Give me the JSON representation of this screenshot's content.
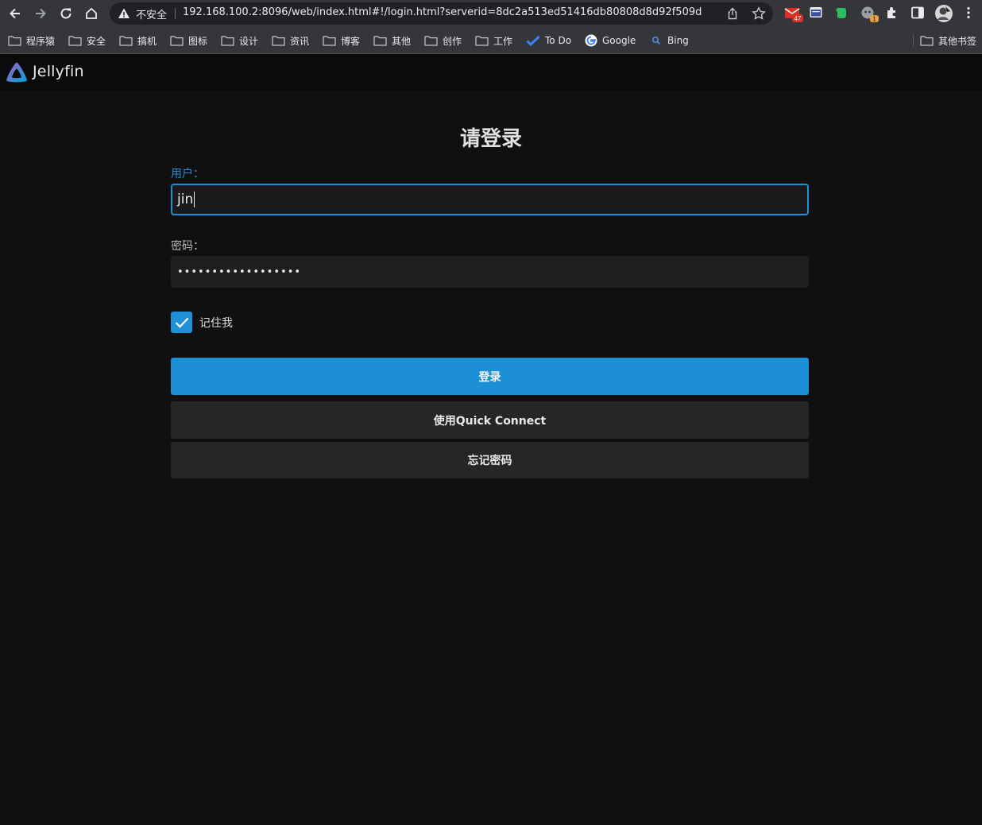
{
  "browser": {
    "omnibox": {
      "security_label": "不安全",
      "url": "192.168.100.2:8096/web/index.html#!/login.html?serverid=8dc2a513ed51416db80808d8d92f509d"
    },
    "extensions": [
      {
        "icon": "mail-extension-icon",
        "badge": "47"
      },
      {
        "icon": "window-extension-icon"
      },
      {
        "icon": "evernote-extension-icon"
      },
      {
        "icon": "wechat-extension-icon",
        "badge": "1"
      },
      {
        "icon": "puzzle-icon"
      },
      {
        "icon": "sidebar-icon"
      },
      {
        "icon": "profile-avatar-icon"
      },
      {
        "icon": "more-vert-icon"
      }
    ],
    "bookmarks": [
      {
        "label": "程序猿",
        "icon": "folder-icon"
      },
      {
        "label": "安全",
        "icon": "folder-icon"
      },
      {
        "label": "搞机",
        "icon": "folder-icon"
      },
      {
        "label": "图标",
        "icon": "folder-icon"
      },
      {
        "label": "设计",
        "icon": "folder-icon"
      },
      {
        "label": "资讯",
        "icon": "folder-icon"
      },
      {
        "label": "博客",
        "icon": "folder-icon"
      },
      {
        "label": "其他",
        "icon": "folder-icon"
      },
      {
        "label": "创作",
        "icon": "folder-icon"
      },
      {
        "label": "工作",
        "icon": "folder-icon"
      },
      {
        "label": "To Do",
        "icon": "todo-icon"
      },
      {
        "label": "Google",
        "icon": "google-icon"
      },
      {
        "label": "Bing",
        "icon": "search-icon"
      }
    ],
    "other_bookmarks": "其他书签"
  },
  "app": {
    "name": "Jellyfin"
  },
  "login": {
    "title": "请登录",
    "username_label": "用户：",
    "username_value": "jin",
    "password_label": "密码：",
    "password_masked": "••••••••••••••••••",
    "remember_label": "记住我",
    "remember_checked": true,
    "submit_label": "登录",
    "quick_connect_label": "使用Quick Connect",
    "forgot_label": "忘记密码"
  },
  "colors": {
    "accent": "#1d8fd5",
    "background": "#101010",
    "header": "#0b0b0b",
    "button_secondary": "#262626"
  }
}
